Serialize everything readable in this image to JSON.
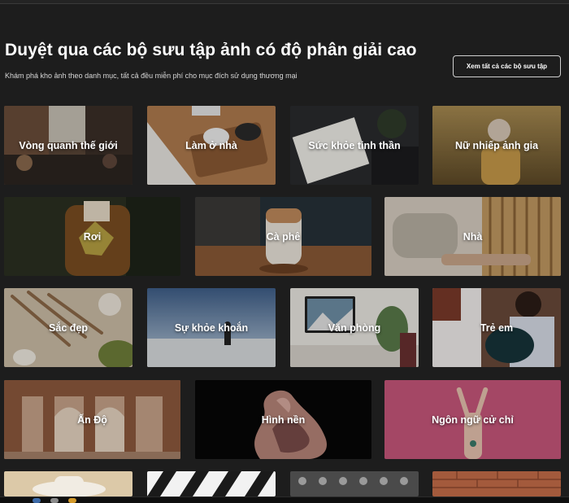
{
  "header": {
    "title": "Duyệt qua các bộ sưu tập ảnh có độ phân giải cao",
    "subtitle": "Khám phá kho ảnh theo danh mục, tất cả đều miễn phí cho mục đích sử dụng thương mại",
    "view_all_label": "Xem tất cả các bộ sưu tập"
  },
  "collections": [
    "Vòng quanh thế giới",
    "Làm ở nhà",
    "Sức khỏe tinh thần",
    "Nữ nhiếp ảnh gia",
    "Rơi",
    "Cà phê",
    "Nhà",
    "Sắc đẹp",
    "Sự khỏe khoắn",
    "Văn phòng",
    "Trẻ em",
    "Ấn Độ",
    "Hình nền",
    "Ngôn ngữ cử chỉ"
  ],
  "colors": {
    "background": "#1d1d1d",
    "text": "#ffffff",
    "button_border": "#cfcfcf"
  }
}
